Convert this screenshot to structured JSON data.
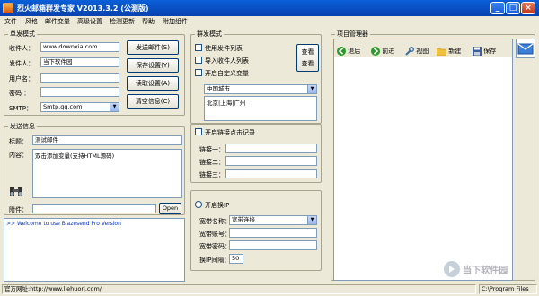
{
  "app": {
    "title": "烈火邮箱群发专家 V2013.3.2 (公测版)"
  },
  "menu": [
    "文件",
    "风格",
    "邮件变量",
    "高级设置",
    "检测更新",
    "帮助",
    "附加组件"
  ],
  "single": {
    "group_label": "单发模式",
    "recipient_label": "收件人：",
    "recipient_value": "www.downxia.com",
    "sender_label": "发件人：",
    "sender_value": "当下软件园",
    "username_label": "用户名：",
    "username_value": "",
    "password_label": "密码  ：",
    "password_value": "",
    "smtp_label": "SMTP：",
    "smtp_value": "Smtp.qq.com",
    "buttons": {
      "send": "发送邮件(S)",
      "save": "保存设置(Y)",
      "read": "读取设置(A)",
      "clear": "清空信息(C)"
    }
  },
  "sendinfo": {
    "group_label": "发送信息",
    "subject_label": "标题：",
    "subject_value": "测试邮件",
    "content_label": "内容：",
    "content_value": "双击添加变量(支持HTML源码)",
    "attach_label": "附件：",
    "attach_value": "",
    "open_button": "Open"
  },
  "log": {
    "text": ">> Welcome to use Blazesend Pro Version"
  },
  "group": {
    "group_label": "群发模式",
    "use_list": "使用发件列表",
    "import_list": "导入收件人列表",
    "custom_var": "开启自定义变量",
    "view1": "查看",
    "view2": "查看",
    "region_select": "中国城市",
    "cities": "北京|上海|广州"
  },
  "links": {
    "enable": "开启链接点击记录",
    "link1_label": "链接一：",
    "link2_label": "链接二：",
    "link3_label": "链接三："
  },
  "ip": {
    "enable": "开启换IP",
    "bb_name_label": "宽带名称：",
    "bb_name_value": "宽带连接",
    "bb_account_label": "宽带账号：",
    "bb_account_value": "",
    "bb_password_label": "宽带密码：",
    "bb_password_value": "",
    "interval_label": "换IP间隔：",
    "interval_value": "50"
  },
  "project": {
    "group_label": "项目管理器",
    "toolbar": {
      "back": "退后",
      "forward": "前进",
      "view": "视图",
      "new": "新建",
      "save": "保存"
    }
  },
  "status": {
    "website": "官方网址:http://www.liehuorj.com/",
    "path": "C:\\Program Files"
  },
  "watermark": "当下软件园",
  "colors": {
    "titlebar": "#0a5fd8",
    "log_text": "#0033cc"
  }
}
